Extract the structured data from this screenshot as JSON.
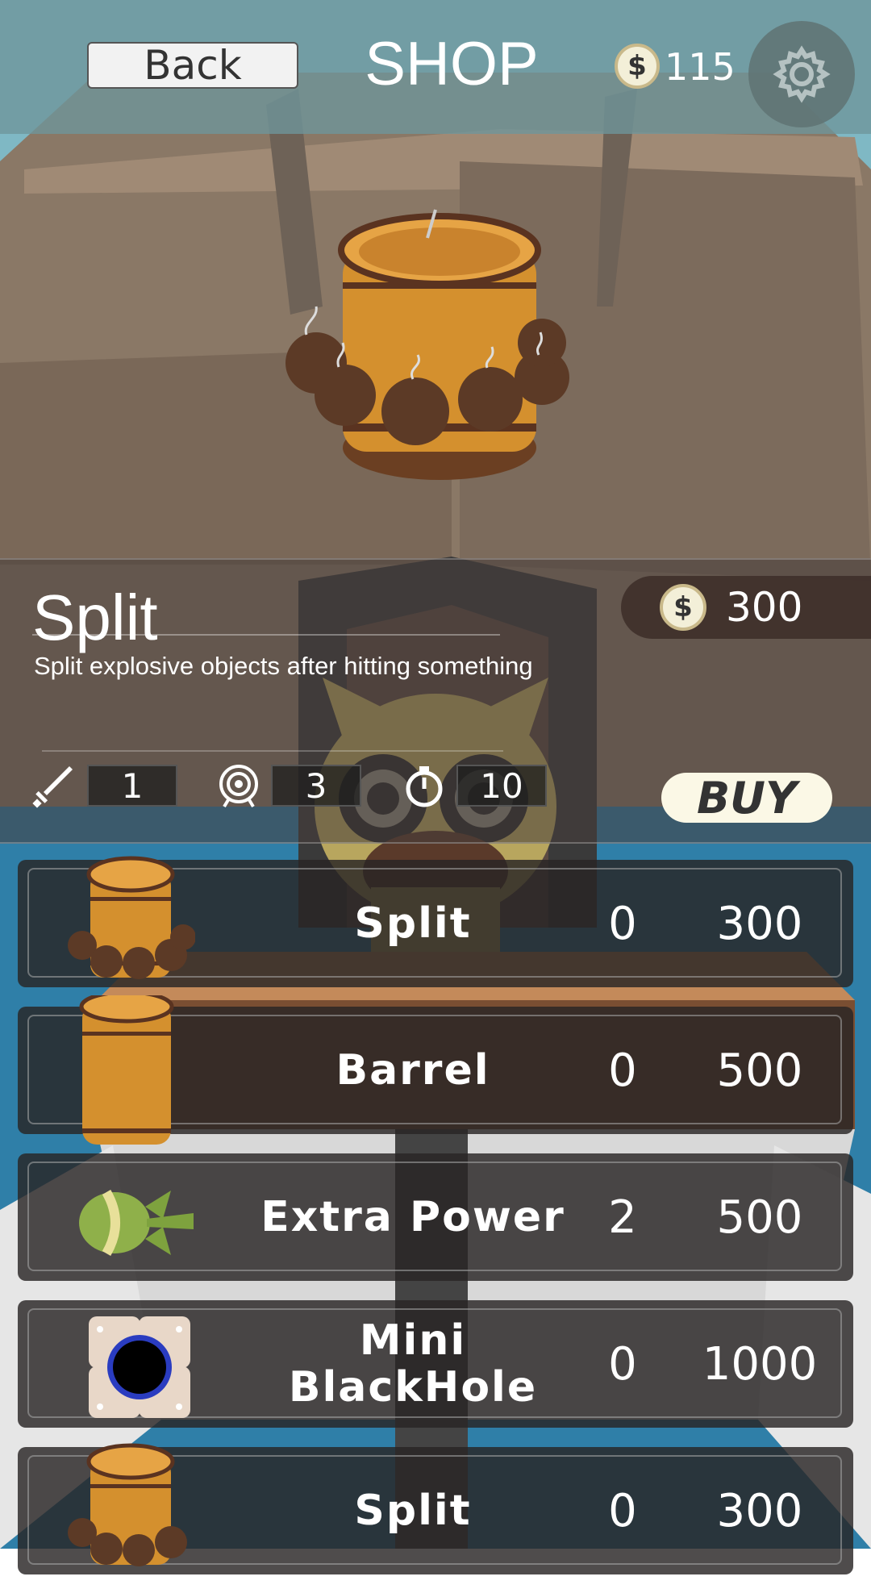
{
  "header": {
    "back_label": "Back",
    "title": "SHOP",
    "coin_symbol": "$",
    "coins": "115",
    "settings_icon": "gear-icon"
  },
  "detail": {
    "name": "Split",
    "description": "Split explosive objects after hitting something",
    "price": "300",
    "coin_symbol": "$",
    "stats": [
      {
        "icon": "sword-icon",
        "value": "1"
      },
      {
        "icon": "target-icon",
        "value": "3"
      },
      {
        "icon": "stopwatch-icon",
        "value": "10"
      }
    ],
    "buy_label": "BUY"
  },
  "items": [
    {
      "name": "Split",
      "owned": "0",
      "price": "300",
      "icon": "split-barrel-icon"
    },
    {
      "name": "Barrel",
      "owned": "0",
      "price": "500",
      "icon": "barrel-icon"
    },
    {
      "name": "Extra Power",
      "owned": "2",
      "price": "500",
      "icon": "rocket-icon"
    },
    {
      "name": "Mini BlackHole",
      "owned": "0",
      "price": "1000",
      "icon": "blackhole-icon"
    },
    {
      "name": "Split",
      "owned": "0",
      "price": "300",
      "icon": "split-barrel-icon"
    }
  ],
  "colors": {
    "topbar": "#6e969b",
    "panel": "#463c3a",
    "buy_button": "#fbf8e6",
    "barrel": "#d4902e"
  }
}
